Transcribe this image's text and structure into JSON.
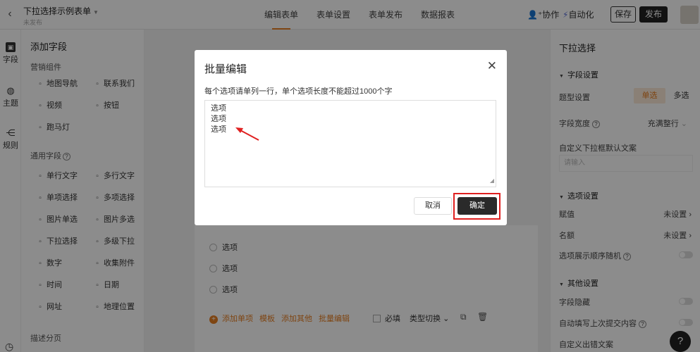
{
  "app": {
    "form_title": "下拉选择示例表单",
    "form_status": "未发布",
    "tabs": [
      {
        "label": "编辑表单",
        "active": true
      },
      {
        "label": "表单设置",
        "active": false
      },
      {
        "label": "表单发布",
        "active": false
      },
      {
        "label": "数据报表",
        "active": false
      }
    ],
    "collab": "协作",
    "automation": "自动化",
    "save": "保存",
    "publish": "发布"
  },
  "leftbar": {
    "items": [
      {
        "label": "字段",
        "icon": "field-icon"
      },
      {
        "label": "主题",
        "icon": "palette-icon"
      },
      {
        "label": "规则",
        "icon": "rules-icon"
      }
    ]
  },
  "fieldpanel": {
    "title": "添加字段",
    "sec_marketing": "营销组件",
    "sec_common": "通用字段",
    "sec_desc": "描述分页",
    "marketing": [
      {
        "label": "地图导航",
        "icon": "map-icon"
      },
      {
        "label": "联系我们",
        "icon": "phone-icon"
      },
      {
        "label": "视频",
        "icon": "video-icon"
      },
      {
        "label": "按钮",
        "icon": "button-icon"
      },
      {
        "label": "跑马灯",
        "icon": "marquee-icon"
      }
    ],
    "common": [
      {
        "label": "单行文字",
        "icon": "text-icon"
      },
      {
        "label": "多行文字",
        "icon": "multiline-icon"
      },
      {
        "label": "单项选择",
        "icon": "radio-icon"
      },
      {
        "label": "多项选择",
        "icon": "checkbox-icon"
      },
      {
        "label": "图片单选",
        "icon": "image-icon"
      },
      {
        "label": "图片多选",
        "icon": "images-icon"
      },
      {
        "label": "下拉选择",
        "icon": "dropdown-icon"
      },
      {
        "label": "多级下拉",
        "icon": "cascade-icon"
      },
      {
        "label": "数字",
        "icon": "number-icon"
      },
      {
        "label": "收集附件",
        "icon": "upload-icon"
      },
      {
        "label": "时间",
        "icon": "clock-icon"
      },
      {
        "label": "日期",
        "icon": "calendar-icon"
      },
      {
        "label": "网址",
        "icon": "link-icon"
      },
      {
        "label": "地理位置",
        "icon": "location-icon"
      }
    ]
  },
  "canvas": {
    "options": [
      "选项",
      "选项",
      "选项"
    ],
    "actions": [
      "添加单项",
      "模板",
      "添加其他",
      "批量编辑"
    ],
    "required": "必填",
    "type_switch": "类型切换"
  },
  "rightpanel": {
    "title": "下拉选择",
    "sec_field": "字段设置",
    "type_label": "题型设置",
    "type_single": "单选",
    "type_multi": "多选",
    "width_label": "字段宽度",
    "width_value": "充满整行",
    "placeholder_label": "自定义下拉框默认文案",
    "placeholder_text": "请输入",
    "sec_options": "选项设置",
    "score_label": "赋值",
    "score_value": "未设置",
    "quota_label": "名额",
    "quota_value": "未设置",
    "random_label": "选项展示顺序随机",
    "sec_other": "其他设置",
    "hide_label": "字段隐藏",
    "autofill_label": "自动填写上次提交内容",
    "custom_err_label": "自定义出错文案"
  },
  "modal": {
    "title": "批量编辑",
    "description": "每个选项请单列一行，单个选项长度不能超过1000个字",
    "lines": [
      "选项",
      "选项",
      "选项"
    ],
    "cancel": "取消",
    "confirm": "确定",
    "highlight_color": "#e02020"
  }
}
